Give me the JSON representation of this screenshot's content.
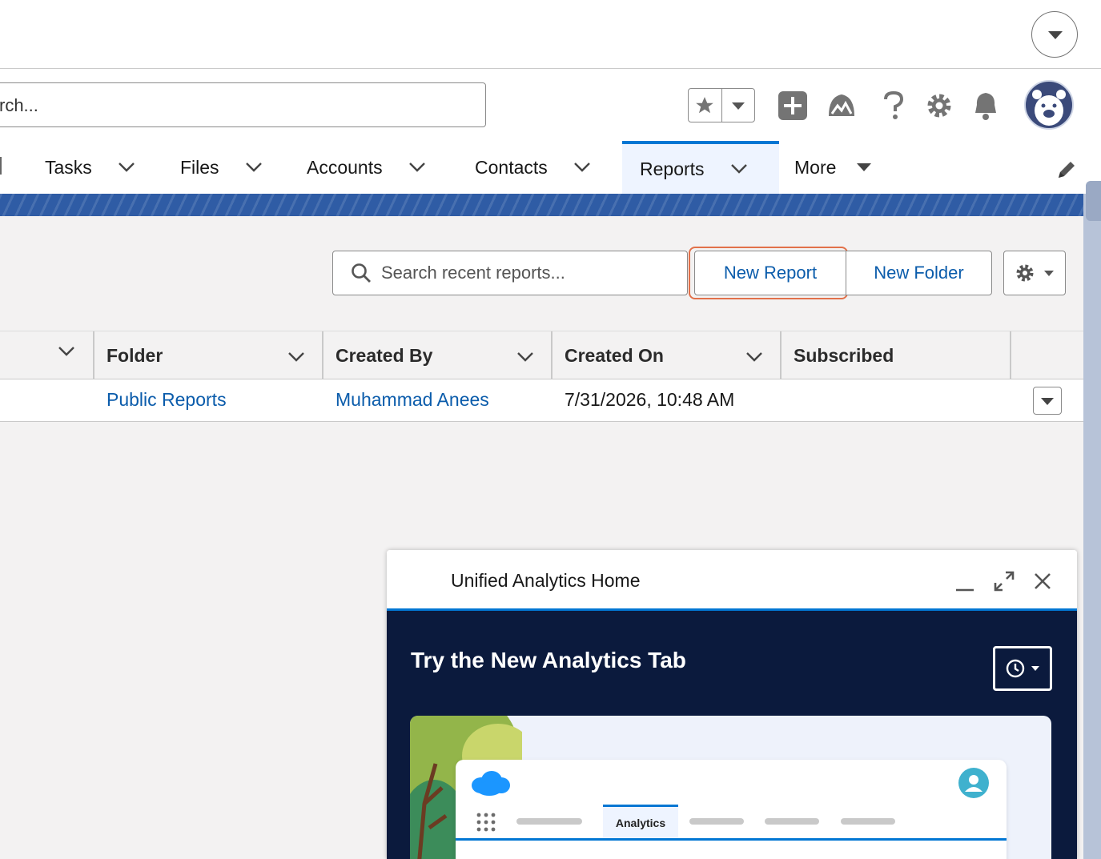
{
  "global_search": {
    "value": "rch..."
  },
  "nav": {
    "items": [
      {
        "label": "Tasks"
      },
      {
        "label": "Files"
      },
      {
        "label": "Accounts"
      },
      {
        "label": "Contacts"
      },
      {
        "label": "Reports",
        "active": true
      },
      {
        "label": "More"
      }
    ]
  },
  "toolbar": {
    "search_placeholder": "Search recent reports...",
    "new_report_label": "New Report",
    "new_folder_label": "New Folder"
  },
  "table": {
    "columns": [
      "Folder",
      "Created By",
      "Created On",
      "Subscribed"
    ],
    "rows": [
      {
        "folder": "Public Reports",
        "created_by": "Muhammad Anees",
        "created_on": "7/31/2026, 10:48 AM",
        "subscribed": ""
      }
    ]
  },
  "popup": {
    "title": "Unified Analytics Home",
    "promo_title": "Try the New Analytics Tab",
    "mock_tab_label": "Analytics"
  },
  "colors": {
    "brand_blue": "#0176d3",
    "link_blue": "#0b5cab",
    "focus_orange": "#e2714a",
    "popup_navy": "#0b1a3d"
  },
  "icons": [
    "chevron-down-icon",
    "star-icon",
    "add-icon",
    "trailhead-icon",
    "help-icon",
    "gear-icon",
    "bell-icon",
    "avatar",
    "pencil-icon",
    "search-icon",
    "minimize-icon",
    "expand-icon",
    "close-icon",
    "clock-icon"
  ]
}
